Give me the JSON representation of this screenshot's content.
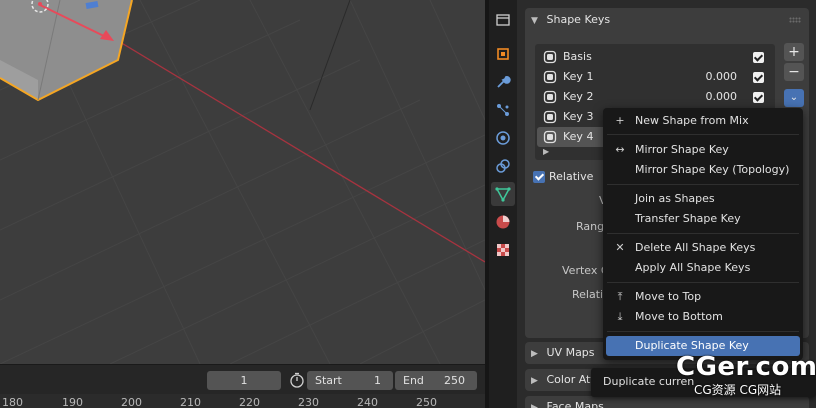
{
  "timeline": {
    "current_frame": "1",
    "start_label": "Start",
    "start_value": "1",
    "end_label": "End",
    "end_value": "250",
    "ruler_ticks": [
      "180",
      "190",
      "200",
      "210",
      "220",
      "230",
      "240",
      "250"
    ]
  },
  "properties": {
    "tabs": [
      "object-icon",
      "modifier-wrench-icon",
      "particles-icon",
      "physics-icon",
      "constraints-icon",
      "object-data-icon",
      "material-icon",
      "texture-icon"
    ],
    "shape_keys": {
      "title": "Shape Keys",
      "items": [
        {
          "name": "Basis",
          "value": ""
        },
        {
          "name": "Key 1",
          "value": "0.000"
        },
        {
          "name": "Key 2",
          "value": "0.000"
        },
        {
          "name": "Key 3",
          "value": ""
        },
        {
          "name": "Key 4",
          "value": ""
        }
      ],
      "add_label": "+",
      "remove_label": "−",
      "specials_label": "⌄",
      "relative_label": "Relative",
      "partial_labels": {
        "value": "V",
        "range": "Range",
        "vertex_group": "Vertex G",
        "relative_to": "Relativ"
      }
    },
    "collapsed_panels": [
      "UV Maps",
      "Color Att",
      "Face Maps"
    ]
  },
  "menu": {
    "items": [
      {
        "icon": "+",
        "label": "New Shape from Mix"
      },
      {
        "icon": "↔",
        "label": "Mirror Shape Key"
      },
      {
        "icon": "",
        "label": "Mirror Shape Key (Topology)"
      },
      {
        "icon": "",
        "label": "Join as Shapes"
      },
      {
        "icon": "",
        "label": "Transfer Shape Key"
      },
      {
        "icon": "✕",
        "label": "Delete All Shape Keys"
      },
      {
        "icon": "",
        "label": "Apply All Shape Keys"
      },
      {
        "icon": "⤒",
        "label": "Move to Top"
      },
      {
        "icon": "⤓",
        "label": "Move to Bottom"
      },
      {
        "icon": "",
        "label": "Duplicate Shape Key"
      }
    ]
  },
  "tooltip": {
    "text": "Duplicate curren"
  },
  "watermark": {
    "main": "CGer.com",
    "sub": "CG资源 CG网站"
  },
  "colors": {
    "accent": "#4772b3",
    "selection_orange": "#f5a623",
    "x_axis": "#b83a44"
  }
}
